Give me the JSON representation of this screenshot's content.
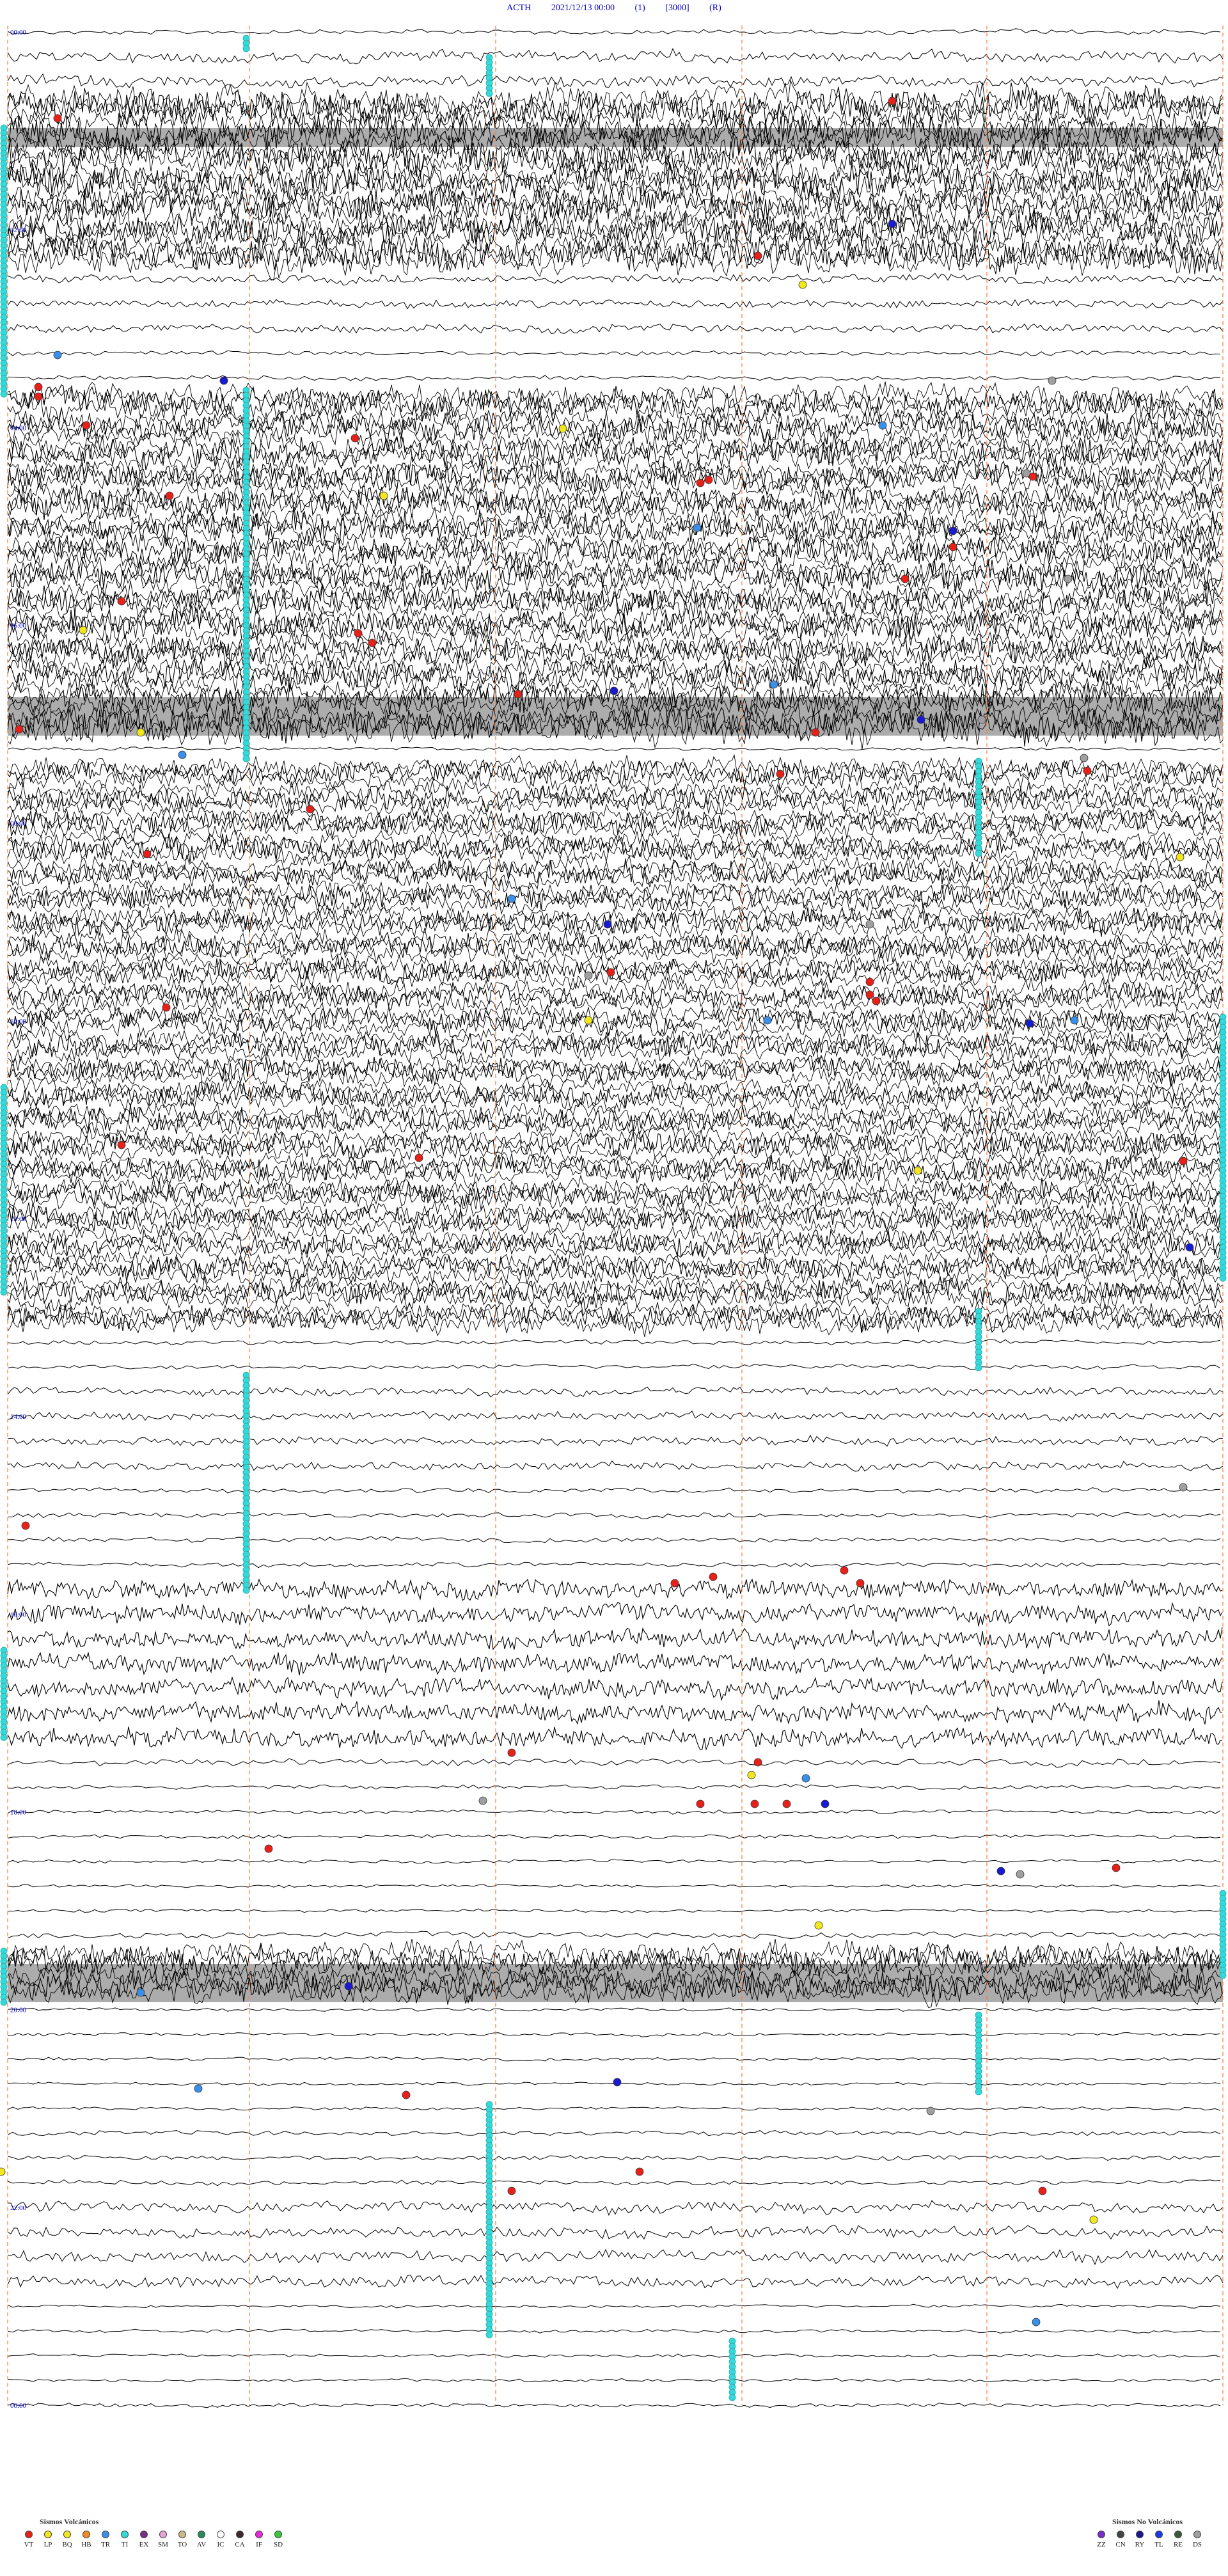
{
  "header": {
    "station": "ACTH",
    "datetime": "2021/12/13 00:00",
    "channel": "(1)",
    "scale": "[3000]",
    "mode": "(R)"
  },
  "hour_labels": [
    "00:00",
    "02:00",
    "04:00",
    "06:00",
    "08:00",
    "10:00",
    "12:00",
    "14:00",
    "16:00",
    "18:00",
    "20:00",
    "22:00",
    "00:00"
  ],
  "legend_volcanic": {
    "title": "Sismos Volcánicos",
    "items": [
      {
        "code": "VT",
        "color": "#e8201a"
      },
      {
        "code": "LP",
        "color": "#f2e61c"
      },
      {
        "code": "BQ",
        "color": "#f2e61c"
      },
      {
        "code": "HB",
        "color": "#f28a1c"
      },
      {
        "code": "TR",
        "color": "#3a8fe8"
      },
      {
        "code": "TI",
        "color": "#35d9d9"
      },
      {
        "code": "EX",
        "color": "#7a2d8f"
      },
      {
        "code": "SM",
        "color": "#e3a3d6"
      },
      {
        "code": "TO",
        "color": "#c9b98a"
      },
      {
        "code": "AV",
        "color": "#2a8a5a"
      },
      {
        "code": "IC",
        "color": "#ffffff"
      },
      {
        "code": "CA",
        "color": "#3a2a2a"
      },
      {
        "code": "IF",
        "color": "#e82ad9"
      },
      {
        "code": "SD",
        "color": "#3ac93a"
      }
    ]
  },
  "legend_nonvolcanic": {
    "title": "Sismos No Volcánicos",
    "items": [
      {
        "code": "ZZ",
        "color": "#7a2dc9"
      },
      {
        "code": "CN",
        "color": "#444444"
      },
      {
        "code": "RY",
        "color": "#1a1a8a"
      },
      {
        "code": "TL",
        "color": "#1a3ae8"
      },
      {
        "code": "RE",
        "color": "#3a5a3a"
      },
      {
        "code": "DS",
        "color": "#a0a0a0"
      }
    ]
  },
  "colors": {
    "trace": "#000000",
    "minute_marker": "#ff7a33",
    "label": "#0000cc",
    "tremor_marker": "#35d9d9"
  }
}
